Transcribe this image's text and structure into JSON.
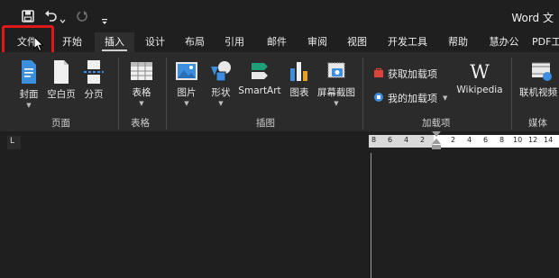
{
  "title_bar": {
    "app_title": "Word 文",
    "icons": [
      "save-icon",
      "undo-icon",
      "undo-dropdown-icon",
      "redo-icon",
      "qat-customize-icon"
    ]
  },
  "tabs": [
    {
      "label": "文件",
      "active": false
    },
    {
      "label": "开始",
      "active": false
    },
    {
      "label": "插入",
      "active": true
    },
    {
      "label": "设计",
      "active": false
    },
    {
      "label": "布局",
      "active": false
    },
    {
      "label": "引用",
      "active": false
    },
    {
      "label": "邮件",
      "active": false
    },
    {
      "label": "审阅",
      "active": false
    },
    {
      "label": "视图",
      "active": false
    },
    {
      "label": "开发工具",
      "active": false
    },
    {
      "label": "帮助",
      "active": false
    },
    {
      "label": "慧办公",
      "active": false
    },
    {
      "label": "PDF工",
      "active": false
    }
  ],
  "ribbon": {
    "pages_group": {
      "label": "页面",
      "buttons": [
        "封面",
        "空白页",
        "分页"
      ]
    },
    "table_group": {
      "label": "表格",
      "buttons": [
        "表格"
      ]
    },
    "illustrations_group": {
      "label": "插图",
      "buttons": [
        "图片",
        "形状",
        "SmartArt",
        "图表",
        "屏幕截图"
      ]
    },
    "addins_group": {
      "label": "加载项",
      "get_addins": "获取加载项",
      "my_addins": "我的加载项",
      "wikipedia": "Wikipedia",
      "wikipedia_glyph": "W"
    },
    "media_group": {
      "label": "媒体",
      "buttons": [
        "联机视频"
      ]
    }
  },
  "ruler": {
    "labels": [
      "8",
      "6",
      "4",
      "2",
      "2",
      "4",
      "6",
      "8",
      "10",
      "12",
      "14"
    ],
    "corner_glyph": "L"
  },
  "colors": {
    "background": "#1f1f1f",
    "ribbon": "#2b2b2b",
    "highlight": "#e01818",
    "accent_blue": "#3c8fde"
  }
}
